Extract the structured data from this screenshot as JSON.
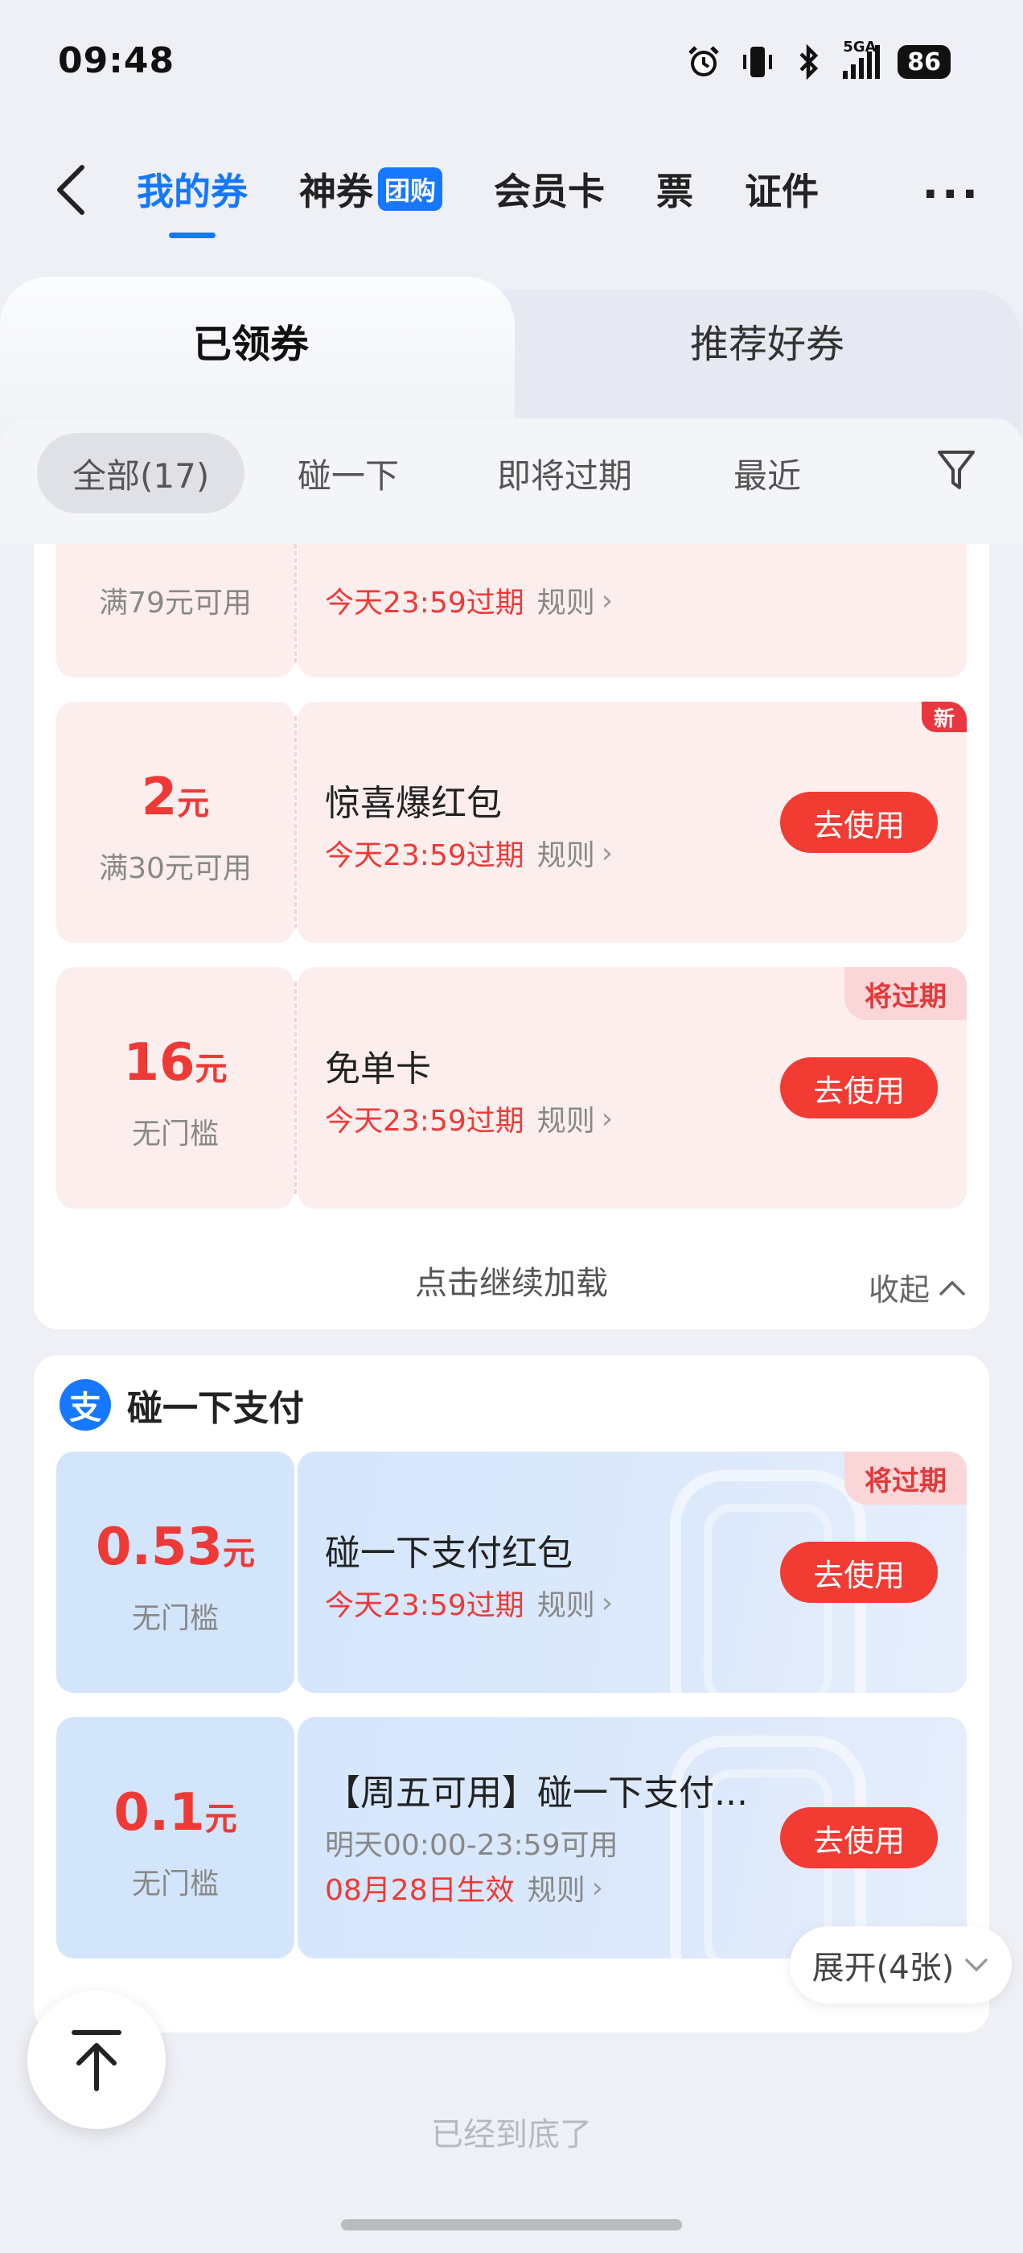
{
  "status_bar": {
    "time": "09:48",
    "network": "5GA",
    "battery": "86"
  },
  "nav": {
    "tabs": [
      {
        "label": "我的券",
        "active": true
      },
      {
        "label": "神券",
        "badge": "团购"
      },
      {
        "label": "会员卡"
      },
      {
        "label": "票"
      },
      {
        "label": "证件"
      }
    ],
    "more": "···"
  },
  "segments": {
    "left": "已领券",
    "right": "推荐好券"
  },
  "filters": [
    "全部(17)",
    "碰一下",
    "即将过期",
    "最近"
  ],
  "coupons_top": [
    {
      "amount": "2",
      "unit": "元",
      "condition": "满30元可用",
      "title": "惊喜爆红包",
      "expire": "今天23:59过期",
      "rule": "规则",
      "button": "去使用",
      "tag": "新"
    },
    {
      "amount": "16",
      "unit": "元",
      "condition": "无门槛",
      "title": "免单卡",
      "expire": "今天23:59过期",
      "rule": "规则",
      "button": "去使用",
      "tag": "将过期"
    }
  ],
  "partial_coupon": {
    "condition": "满79元可用",
    "expire": "今天23:59过期",
    "rule": "规则"
  },
  "load_more": "点击继续加载",
  "collapse": "收起",
  "section": {
    "icon": "支",
    "title": "碰一下支付",
    "coupons": [
      {
        "amount": "0.53",
        "unit": "元",
        "condition": "无门槛",
        "title": "碰一下支付红包",
        "expire": "今天23:59过期",
        "rule": "规则",
        "button": "去使用",
        "tag": "将过期"
      },
      {
        "amount": "0.1",
        "unit": "元",
        "condition": "无门槛",
        "title": "【周五可用】碰一下支付...",
        "sub": "明天00:00-23:59可用",
        "expire": "08月28日生效",
        "rule": "规则",
        "button": "去使用"
      }
    ],
    "expand": "展开(4张)"
  },
  "bottom_text": "已经到底了"
}
